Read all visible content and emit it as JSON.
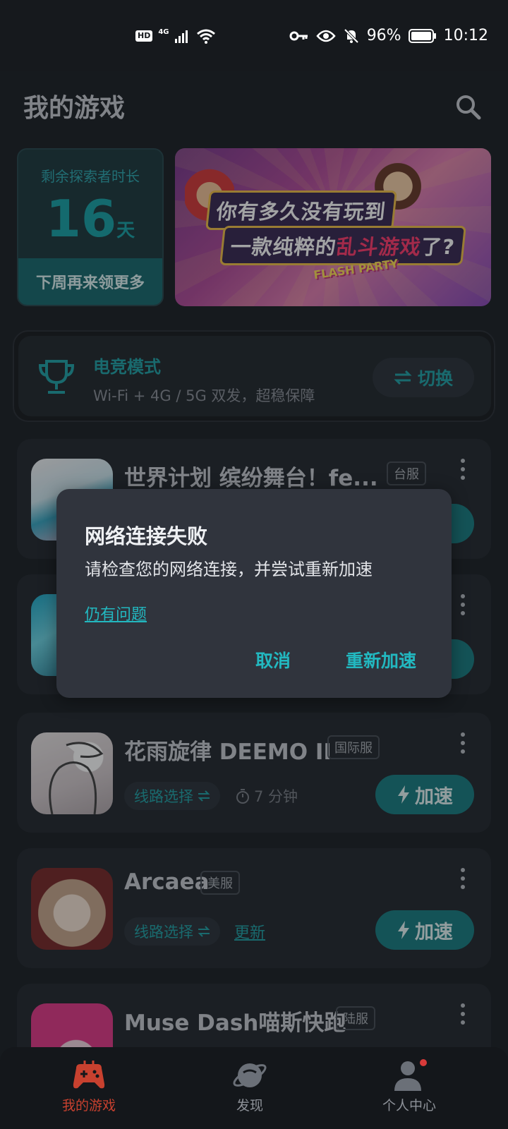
{
  "status_bar": {
    "hd": "HD",
    "network": "4G",
    "battery": "96%",
    "time": "10:12"
  },
  "header": {
    "title": "我的游戏",
    "search_icon": "search-icon"
  },
  "explorer": {
    "label": "剩余探索者时长",
    "days": "16",
    "unit": "天",
    "footer": "下周再来领更多"
  },
  "banner": {
    "line1": "你有多久没有玩到",
    "line2_pre": "一款纯粹的",
    "line2_highlight": "乱斗游戏",
    "line2_post": "了?",
    "logo": "FLASH PARTY"
  },
  "esports": {
    "title": "电竞模式",
    "subtitle": "Wi-Fi + 4G / 5G 双发，超稳保障",
    "switch_label": "切换",
    "icon": "trophy-icon"
  },
  "games": [
    {
      "name": "世界计划 缤纷舞台！fe...",
      "server": "台服"
    },
    {
      "name": "",
      "server": ""
    },
    {
      "name": "花雨旋律 DEEMO II",
      "server": "国际服",
      "route": "线路选择",
      "time": "7 分钟",
      "boost": "加速"
    },
    {
      "name": "Arcaea",
      "server": "美服",
      "route": "线路选择",
      "update": "更新",
      "boost": "加速"
    },
    {
      "name": "Muse Dash喵斯快跑",
      "server": "陆服"
    }
  ],
  "dialog": {
    "title": "网络连接失败",
    "message": "请检查您的网络连接，并尝试重新加速",
    "link": "仍有问题",
    "cancel": "取消",
    "confirm": "重新加速"
  },
  "bottom_nav": [
    {
      "label": "我的游戏",
      "icon": "gamepad-icon",
      "active": true
    },
    {
      "label": "发现",
      "icon": "planet-icon",
      "active": false
    },
    {
      "label": "个人中心",
      "icon": "user-icon",
      "active": false
    }
  ],
  "colors": {
    "accent": "#22a4a8",
    "nav_active": "#c8412f",
    "background": "#1e2227"
  }
}
